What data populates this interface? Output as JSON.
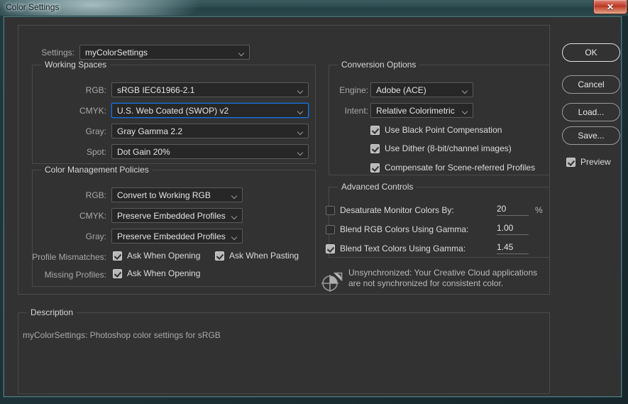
{
  "window": {
    "title": "Color Settings",
    "close_label": "✕"
  },
  "settings_row": {
    "label": "Settings:",
    "value": "myColorSettings"
  },
  "working_spaces": {
    "title": "Working Spaces",
    "rows": [
      {
        "label": "RGB:",
        "value": "sRGB IEC61966-2.1"
      },
      {
        "label": "CMYK:",
        "value": "U.S. Web Coated (SWOP) v2"
      },
      {
        "label": "Gray:",
        "value": "Gray Gamma 2.2"
      },
      {
        "label": "Spot:",
        "value": "Dot Gain 20%"
      }
    ]
  },
  "color_management_policies": {
    "title": "Color Management Policies",
    "rows": [
      {
        "label": "RGB:",
        "value": "Convert to Working RGB"
      },
      {
        "label": "CMYK:",
        "value": "Preserve Embedded Profiles"
      },
      {
        "label": "Gray:",
        "value": "Preserve Embedded Profiles"
      }
    ],
    "profile_mismatches_label": "Profile Mismatches:",
    "mismatch_open_label": "Ask When Opening",
    "mismatch_paste_label": "Ask When Pasting",
    "missing_profiles_label": "Missing Profiles:",
    "missing_open_label": "Ask When Opening",
    "mismatch_open_checked": true,
    "mismatch_paste_checked": true,
    "missing_open_checked": true
  },
  "conversion_options": {
    "title": "Conversion Options",
    "engine_label": "Engine:",
    "engine_value": "Adobe (ACE)",
    "intent_label": "Intent:",
    "intent_value": "Relative Colorimetric",
    "black_point_label": "Use Black Point Compensation",
    "black_point_checked": true,
    "dither_label": "Use Dither (8-bit/channel images)",
    "dither_checked": true,
    "scene_referred_label": "Compensate for Scene-referred Profiles",
    "scene_referred_checked": true
  },
  "advanced_controls": {
    "title": "Advanced Controls",
    "desaturate_label": "Desaturate Monitor Colors By:",
    "desaturate_checked": false,
    "desaturate_value": "20",
    "desaturate_unit": "%",
    "blend_rgb_label": "Blend RGB Colors Using Gamma:",
    "blend_rgb_checked": false,
    "blend_rgb_value": "1.00",
    "blend_text_label": "Blend Text Colors Using Gamma:",
    "blend_text_checked": true,
    "blend_text_value": "1.45"
  },
  "sync_notice": {
    "text": "Unsynchronized: Your Creative Cloud applications\nare not synchronized for consistent color.",
    "icon": "sync-status-icon"
  },
  "description": {
    "title": "Description",
    "text": "myColorSettings:  Photoshop color settings for sRGB"
  },
  "buttons": {
    "ok": "OK",
    "cancel": "Cancel",
    "load": "Load...",
    "save": "Save...",
    "preview_label": "Preview",
    "preview_checked": true
  },
  "colors": {
    "accent_focus": "#1473e6",
    "panel_bg": "#323232",
    "field_bg": "#272727",
    "titlebar": "#2c4a4f",
    "close_red": "#b63422"
  }
}
